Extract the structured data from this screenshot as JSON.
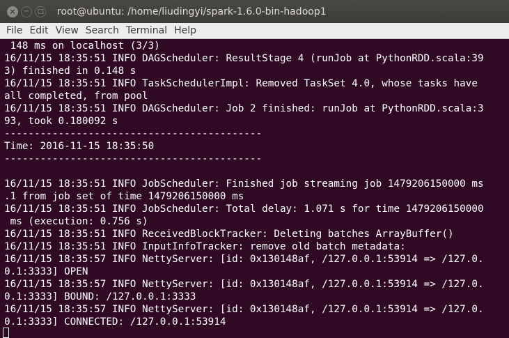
{
  "window": {
    "title": "root@ubuntu: /home/liudingyi/spark-1.6.0-bin-hadoop1",
    "buttons": {
      "close": "×",
      "minimize": "−",
      "maximize": "□"
    }
  },
  "menu": [
    "File",
    "Edit",
    "View",
    "Search",
    "Terminal",
    "Help"
  ],
  "terminal": {
    "lines": [
      " 148 ms on localhost (3/3)",
      "16/11/15 18:35:51 INFO DAGScheduler: ResultStage 4 (runJob at PythonRDD.scala:39",
      "3) finished in 0.148 s",
      "16/11/15 18:35:51 INFO TaskSchedulerImpl: Removed TaskSet 4.0, whose tasks have",
      "all completed, from pool",
      "16/11/15 18:35:51 INFO DAGScheduler: Job 2 finished: runJob at PythonRDD.scala:3",
      "93, took 0.180092 s",
      "-------------------------------------------",
      "Time: 2016-11-15 18:35:50",
      "-------------------------------------------",
      "",
      "16/11/15 18:35:51 INFO JobScheduler: Finished job streaming job 1479206150000 ms",
      ".1 from job set of time 1479206150000 ms",
      "16/11/15 18:35:51 INFO JobScheduler: Total delay: 1.071 s for time 1479206150000",
      " ms (execution: 0.756 s)",
      "16/11/15 18:35:51 INFO ReceivedBlockTracker: Deleting batches ArrayBuffer()",
      "16/11/15 18:35:51 INFO InputInfoTracker: remove old batch metadata:",
      "16/11/15 18:35:57 INFO NettyServer: [id: 0x130148af, /127.0.0.1:53914 => /127.0.",
      "0.1:3333] OPEN",
      "16/11/15 18:35:57 INFO NettyServer: [id: 0x130148af, /127.0.0.1:53914 => /127.0.",
      "0.1:3333] BOUND: /127.0.0.1:3333",
      "16/11/15 18:35:57 INFO NettyServer: [id: 0x130148af, /127.0.0.1:53914 => /127.0.",
      "0.1:3333] CONNECTED: /127.0.0.1:53914"
    ]
  }
}
